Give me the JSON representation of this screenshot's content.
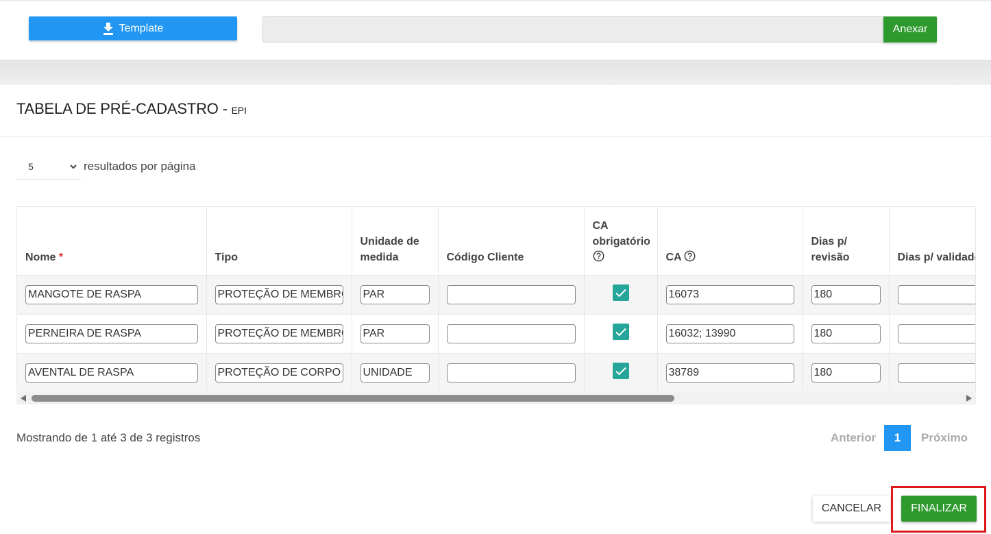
{
  "upload": {
    "template_label": "Template",
    "attach_label": "Anexar",
    "file_value": ""
  },
  "page": {
    "title": "TABELA DE PRÉ-CADASTRO -",
    "subtitle": "EPI"
  },
  "pagination_size": {
    "value": "5",
    "label": "resultados por página"
  },
  "table": {
    "headers": {
      "nome": "Nome",
      "required_marker": "*",
      "tipo": "Tipo",
      "unidade": "Unidade de medida",
      "codigo": "Código Cliente",
      "ca_obrigatorio": "CA obrigatório",
      "ca": "CA",
      "dias_revisao": "Dias p/ revisão",
      "dias_validade": "Dias p/ validade"
    },
    "rows": [
      {
        "nome": "MANGOTE DE RASPA",
        "tipo": "PROTEÇÃO DE MEMBROS SUPERIORES",
        "unidade": "PAR",
        "codigo": "",
        "ca_obrigatorio": true,
        "ca": "16073",
        "dias_revisao": "180",
        "dias_validade": ""
      },
      {
        "nome": "PERNEIRA DE RASPA",
        "tipo": "PROTEÇÃO DE MEMBROS INFERIORES",
        "unidade": "PAR",
        "codigo": "",
        "ca_obrigatorio": true,
        "ca": "16032; 13990",
        "dias_revisao": "180",
        "dias_validade": ""
      },
      {
        "nome": "AVENTAL DE RASPA",
        "tipo": "PROTEÇÃO DE CORPO INTEIRO",
        "unidade": "UNIDADE",
        "codigo": "",
        "ca_obrigatorio": true,
        "ca": "38789",
        "dias_revisao": "180",
        "dias_validade": ""
      }
    ]
  },
  "footer": {
    "records_info": "Mostrando de 1 até 3 de 3 registros",
    "prev_label": "Anterior",
    "current_page": "1",
    "next_label": "Próximo"
  },
  "actions": {
    "cancel_label": "CANCELAR",
    "finish_label": "FINALIZAR"
  },
  "colors": {
    "primary": "#2196f3",
    "success": "#2e9a2e",
    "checkbox": "#26a69a",
    "highlight": "#e01a1a",
    "required": "#e53935"
  }
}
